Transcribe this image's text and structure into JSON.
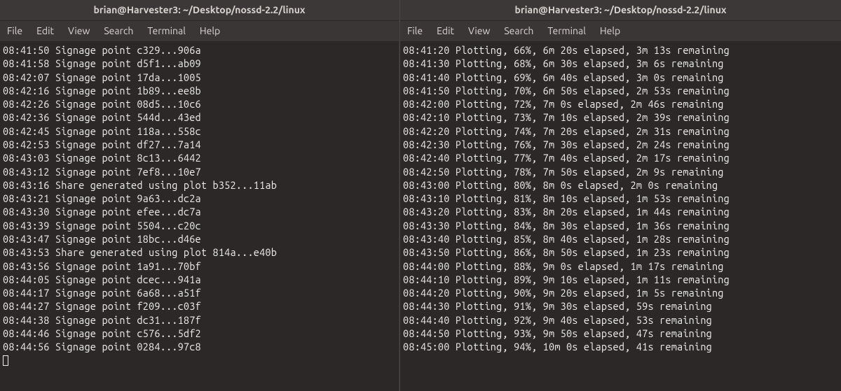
{
  "left": {
    "title": "brian@Harvester3: ~/Desktop/nossd-2.2/linux",
    "menu": [
      "File",
      "Edit",
      "View",
      "Search",
      "Terminal",
      "Help"
    ],
    "lines": [
      "08:41:50 Signage point c329...906a",
      "08:41:58 Signage point d5f1...ab09",
      "08:42:07 Signage point 17da...1005",
      "08:42:16 Signage point 1b89...ee8b",
      "08:42:26 Signage point 08d5...10c6",
      "08:42:36 Signage point 544d...43ed",
      "08:42:45 Signage point 118a...558c",
      "08:42:53 Signage point df27...7a14",
      "08:43:03 Signage point 8c13...6442",
      "08:43:12 Signage point 7ef8...10e7",
      "08:43:16 Share generated using plot b352...11ab",
      "08:43:21 Signage point 9a63...dc2a",
      "08:43:30 Signage point efee...dc7a",
      "08:43:39 Signage point 5504...c20c",
      "08:43:47 Signage point 18bc...d46e",
      "08:43:53 Share generated using plot 814a...e40b",
      "08:43:56 Signage point 1a91...70bf",
      "08:44:05 Signage point dcec...941a",
      "08:44:17 Signage point 6a68...a51f",
      "08:44:27 Signage point f209...c03f",
      "08:44:38 Signage point dc31...187f",
      "08:44:46 Signage point c576...5df2",
      "08:44:56 Signage point 0284...97c8"
    ]
  },
  "right": {
    "title": "brian@Harvester3: ~/Desktop/nossd-2.2/linux",
    "menu": [
      "File",
      "Edit",
      "View",
      "Search",
      "Terminal",
      "Help"
    ],
    "lines": [
      "08:41:20 Plotting, 66%, 6m 20s elapsed, 3m 13s remaining",
      "08:41:30 Plotting, 68%, 6m 30s elapsed, 3m 6s remaining",
      "08:41:40 Plotting, 69%, 6m 40s elapsed, 3m 0s remaining",
      "08:41:50 Plotting, 70%, 6m 50s elapsed, 2m 53s remaining",
      "08:42:00 Plotting, 72%, 7m 0s elapsed, 2m 46s remaining",
      "08:42:10 Plotting, 73%, 7m 10s elapsed, 2m 39s remaining",
      "08:42:20 Plotting, 74%, 7m 20s elapsed, 2m 31s remaining",
      "08:42:30 Plotting, 76%, 7m 30s elapsed, 2m 24s remaining",
      "08:42:40 Plotting, 77%, 7m 40s elapsed, 2m 17s remaining",
      "08:42:50 Plotting, 78%, 7m 50s elapsed, 2m 9s remaining",
      "08:43:00 Plotting, 80%, 8m 0s elapsed, 2m 0s remaining",
      "08:43:10 Plotting, 81%, 8m 10s elapsed, 1m 53s remaining",
      "08:43:20 Plotting, 83%, 8m 20s elapsed, 1m 44s remaining",
      "08:43:30 Plotting, 84%, 8m 30s elapsed, 1m 36s remaining",
      "08:43:40 Plotting, 85%, 8m 40s elapsed, 1m 28s remaining",
      "08:43:50 Plotting, 86%, 8m 50s elapsed, 1m 23s remaining",
      "08:44:00 Plotting, 88%, 9m 0s elapsed, 1m 17s remaining",
      "08:44:10 Plotting, 89%, 9m 10s elapsed, 1m 11s remaining",
      "08:44:20 Plotting, 90%, 9m 20s elapsed, 1m 5s remaining",
      "08:44:30 Plotting, 91%, 9m 30s elapsed, 59s remaining",
      "08:44:40 Plotting, 92%, 9m 40s elapsed, 53s remaining",
      "08:44:50 Plotting, 93%, 9m 50s elapsed, 47s remaining",
      "08:45:00 Plotting, 94%, 10m 0s elapsed, 41s remaining"
    ]
  }
}
